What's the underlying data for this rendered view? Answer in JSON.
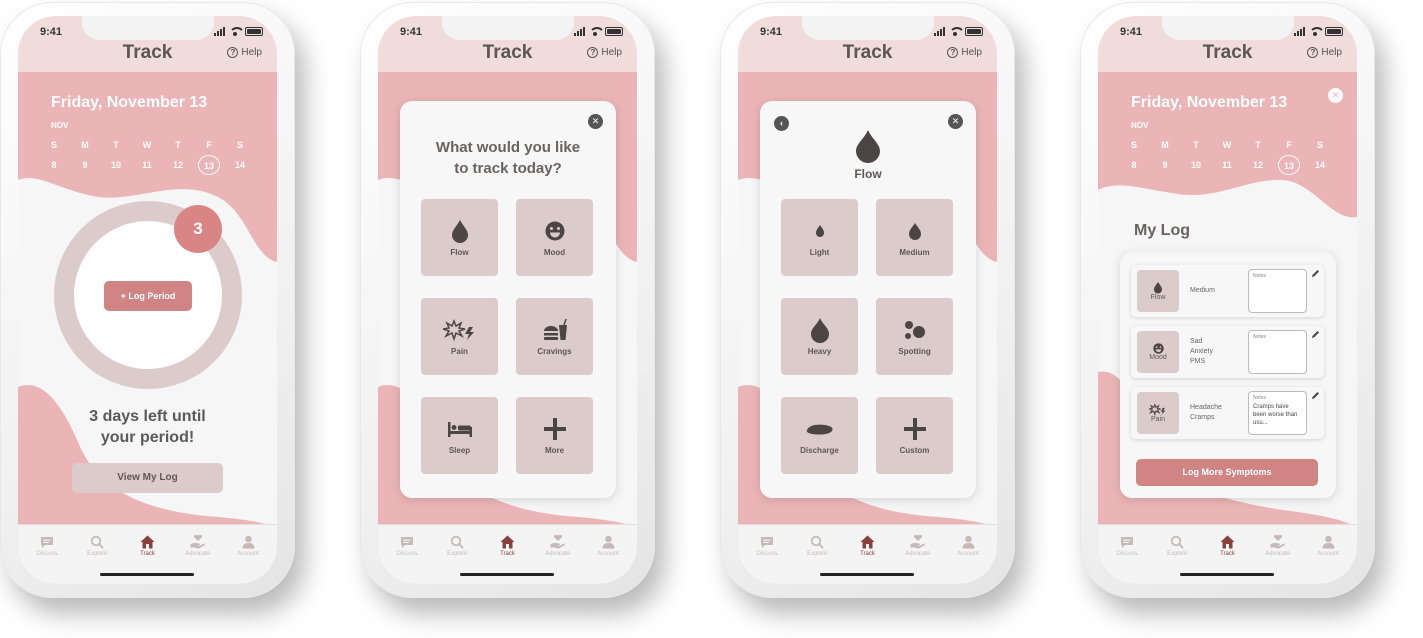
{
  "status_bar": {
    "time": "9:41"
  },
  "header": {
    "title": "Track",
    "help_label": "Help"
  },
  "tab_bar": {
    "tabs": [
      "Discuss",
      "Explore",
      "Track",
      "Advocate",
      "Account"
    ],
    "active": "Track"
  },
  "calendar": {
    "date_title": "Friday, November 13",
    "month": "NOV",
    "weekdays": [
      "S",
      "M",
      "T",
      "W",
      "T",
      "F",
      "S"
    ],
    "days": [
      "8",
      "9",
      "10",
      "11",
      "12",
      "13",
      "14"
    ],
    "selected_day": "13"
  },
  "screen1": {
    "days_badge": "3",
    "log_period_button": "+ Log Period",
    "message_line1": "3 days left until",
    "message_line2": "your period!",
    "view_log_button": "View My Log"
  },
  "screen2": {
    "question_line1": "What would you like",
    "question_line2": "to track today?",
    "options": [
      "Flow",
      "Mood",
      "Pain",
      "Cravings",
      "Sleep",
      "More"
    ]
  },
  "screen3": {
    "category": "Flow",
    "options": [
      "Light",
      "Medium",
      "Heavy",
      "Spotting",
      "Discharge",
      "Custom"
    ]
  },
  "screen4": {
    "section_title": "My Log",
    "entries": [
      {
        "category": "Flow",
        "values": [
          "Medium"
        ],
        "notes_label": "Notes",
        "notes_text": ""
      },
      {
        "category": "Mood",
        "values": [
          "Sad",
          "Anxiety",
          "PMS"
        ],
        "notes_label": "Notes",
        "notes_text": ""
      },
      {
        "category": "Pain",
        "values": [
          "Headache",
          "Cramps"
        ],
        "notes_label": "Notes",
        "notes_text": "Cramps have been worse than usu..."
      }
    ],
    "log_more_button": "Log More Symptoms"
  },
  "colors": {
    "header_pink": "#f1dcdc",
    "background_pink": "#ebb5b7",
    "accent": "#d08484",
    "tile": "#dccbcb",
    "active_tab": "#8a3f3f"
  }
}
